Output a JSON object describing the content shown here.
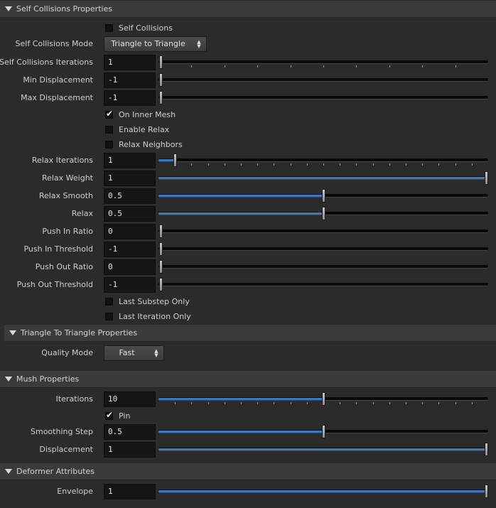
{
  "sections": {
    "self_collisions": {
      "title": "Self Collisions Properties"
    },
    "tri_to_tri": {
      "title": "Triangle To Triangle Properties"
    },
    "mush": {
      "title": "Mush Properties"
    },
    "deformer": {
      "title": "Deformer Attributes"
    }
  },
  "self_collisions": {
    "self_collisions_label": "Self Collisions",
    "self_collisions_checked": false,
    "mode_label": "Self Collisions Mode",
    "mode_value": "Triangle to Triangle",
    "iterations_label": "Self Collisions Iterations",
    "iterations_value": "1",
    "min_disp_label": "Min Displacement",
    "min_disp_value": "-1",
    "max_disp_label": "Max Displacement",
    "max_disp_value": "-1",
    "on_inner_mesh_label": "On Inner Mesh",
    "on_inner_mesh_checked": true,
    "enable_relax_label": "Enable Relax",
    "enable_relax_checked": false,
    "relax_neighbors_label": "Relax Neighbors",
    "relax_neighbors_checked": false,
    "relax_iterations_label": "Relax Iterations",
    "relax_iterations_value": "1",
    "relax_weight_label": "Relax Weight",
    "relax_weight_value": "1",
    "relax_smooth_label": "Relax Smooth",
    "relax_smooth_value": "0.5",
    "relax_label": "Relax",
    "relax_value": "0.5",
    "push_in_ratio_label": "Push In Ratio",
    "push_in_ratio_value": "0",
    "push_in_threshold_label": "Push In Threshold",
    "push_in_threshold_value": "-1",
    "push_out_ratio_label": "Push Out Ratio",
    "push_out_ratio_value": "0",
    "push_out_threshold_label": "Push Out Threshold",
    "push_out_threshold_value": "-1",
    "last_substep_label": "Last Substep Only",
    "last_substep_checked": false,
    "last_iteration_label": "Last Iteration Only",
    "last_iteration_checked": false
  },
  "tri_to_tri": {
    "quality_mode_label": "Quality Mode",
    "quality_mode_value": "Fast"
  },
  "mush": {
    "iterations_label": "Iterations",
    "iterations_value": "10",
    "pin_label": "Pin",
    "pin_checked": true,
    "smoothing_step_label": "Smoothing Step",
    "smoothing_step_value": "0.5",
    "displacement_label": "Displacement",
    "displacement_value": "1"
  },
  "deformer": {
    "envelope_label": "Envelope",
    "envelope_value": "1"
  },
  "sliders": {
    "self_collisions_iterations": 0.0,
    "min_displacement": 0.0,
    "max_displacement": 0.0,
    "relax_iterations": 0.05,
    "relax_weight": 1.0,
    "relax_smooth": 0.5,
    "relax": 0.5,
    "push_in_ratio": 0.0,
    "push_in_threshold": 0.0,
    "push_out_ratio": 0.0,
    "push_out_threshold": 0.0,
    "mush_iterations": 0.5,
    "smoothing_step": 0.5,
    "mush_displacement": 1.0,
    "envelope": 1.0
  },
  "colors": {
    "slider_fill": "#3a78c6",
    "background": "#2b2b2b",
    "header": "#3b3b3b"
  }
}
